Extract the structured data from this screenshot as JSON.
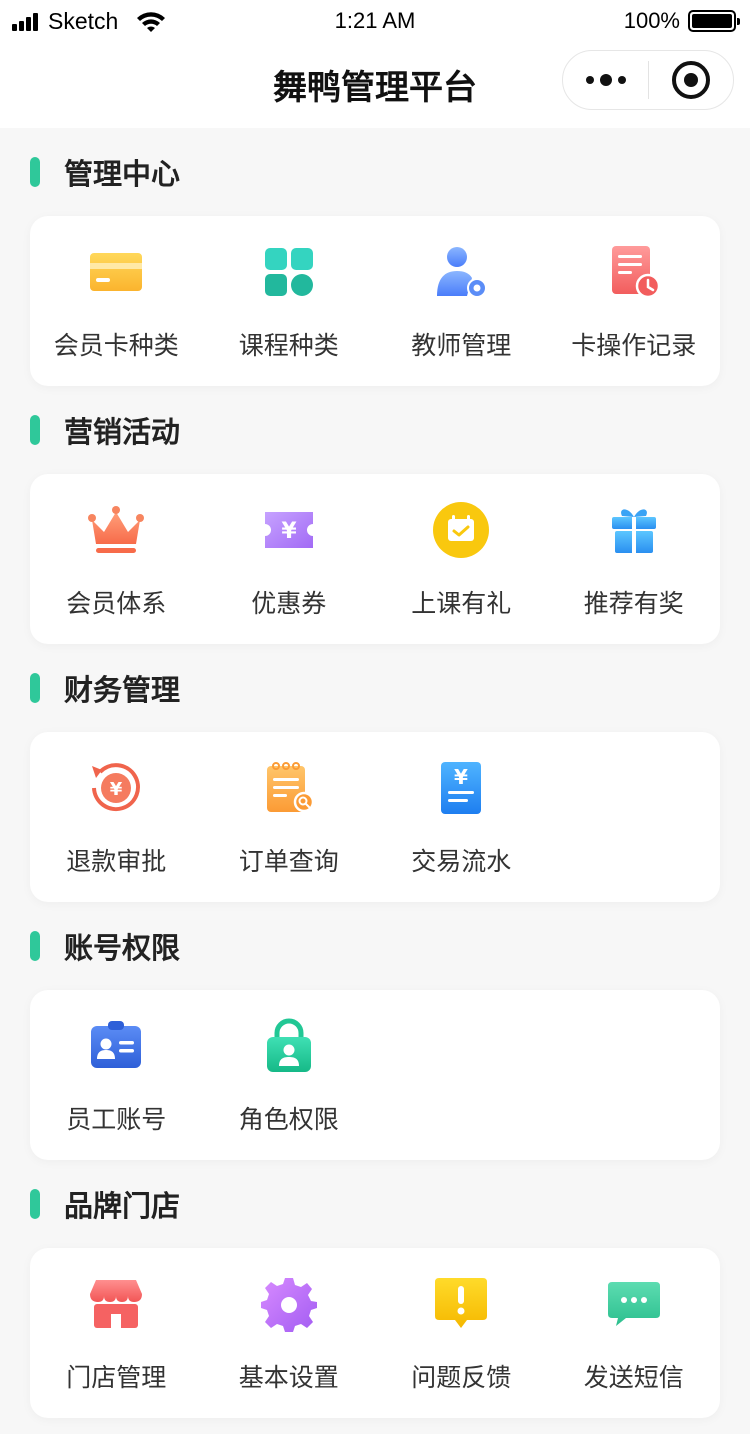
{
  "status_bar": {
    "carrier": "Sketch",
    "time": "1:21 AM",
    "battery": "100%"
  },
  "nav": {
    "title": "舞鸭管理平台"
  },
  "colors": {
    "accent": "#2fc89a"
  },
  "sections": [
    {
      "title": "管理中心",
      "items": [
        {
          "label": "会员卡种类",
          "icon": "card-icon"
        },
        {
          "label": "课程种类",
          "icon": "grid-icon"
        },
        {
          "label": "教师管理",
          "icon": "user-gear-icon"
        },
        {
          "label": "卡操作记录",
          "icon": "record-clock-icon"
        }
      ]
    },
    {
      "title": "营销活动",
      "items": [
        {
          "label": "会员体系",
          "icon": "crown-icon"
        },
        {
          "label": "优惠券",
          "icon": "coupon-icon"
        },
        {
          "label": "上课有礼",
          "icon": "calendar-check-icon"
        },
        {
          "label": "推荐有奖",
          "icon": "gift-icon"
        }
      ]
    },
    {
      "title": "财务管理",
      "items": [
        {
          "label": "退款审批",
          "icon": "refund-icon"
        },
        {
          "label": "订单查询",
          "icon": "order-search-icon"
        },
        {
          "label": "交易流水",
          "icon": "transaction-icon"
        }
      ]
    },
    {
      "title": "账号权限",
      "items": [
        {
          "label": "员工账号",
          "icon": "staff-id-icon"
        },
        {
          "label": "角色权限",
          "icon": "lock-user-icon"
        }
      ]
    },
    {
      "title": "品牌门店",
      "items": [
        {
          "label": "门店管理",
          "icon": "store-icon"
        },
        {
          "label": "基本设置",
          "icon": "settings-gear-icon"
        },
        {
          "label": "问题反馈",
          "icon": "feedback-icon"
        },
        {
          "label": "发送短信",
          "icon": "message-icon"
        }
      ]
    }
  ]
}
